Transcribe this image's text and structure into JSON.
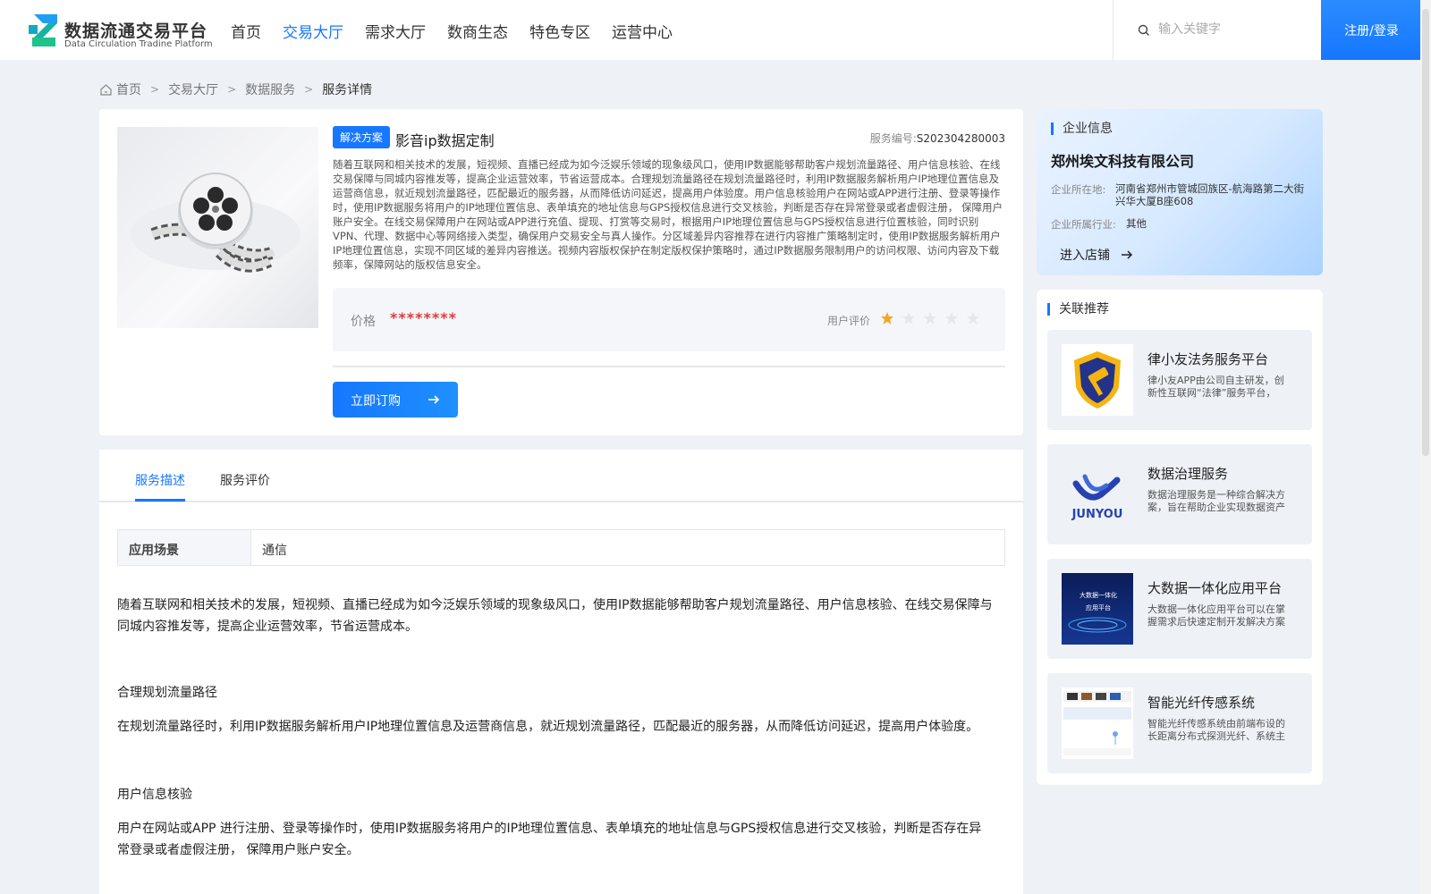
{
  "header": {
    "logo_title": "数据流通交易平台",
    "logo_subtitle": "Data Circulation Tradine Platform",
    "nav": [
      "首页",
      "交易大厅",
      "需求大厅",
      "数商生态",
      "特色专区",
      "运营中心"
    ],
    "active_nav_index": 1,
    "search_placeholder": "输入关键字",
    "login_label": "注册/登录"
  },
  "breadcrumb": [
    "首页",
    "交易大厅",
    "数据服务",
    "服务详情"
  ],
  "product": {
    "tag": "解决方案",
    "title": "影音ip数据定制",
    "service_no_label": "服务编号:",
    "service_no": "S202304280003",
    "description": "随着互联网和相关技术的发展，短视频、直播已经成为如今泛娱乐领域的现象级风口，使用IP数据能够帮助客户规划流量路径、用户信息核验、在线交易保障与同城内容推发等，提高企业运营效率，节省运营成本。合理规划流量路径在规划流量路径时，利用IP数据服务解析用户IP地理位置信息及运营商信息，就近规划流量路径，匹配最近的服务器，从而降低访问延迟，提高用户体验度。用户信息核验用户在网站或APP进行注册、登录等操作时，使用IP数据服务将用户的IP地理位置信息、表单填充的地址信息与GPS授权信息进行交叉核验，判断是否存在异常登录或者虚假注册， 保障用户账户安全。在线交易保障用户在网站或APP进行充值、提现、打赏等交易时，根据用户IP地理位置信息与GPS授权信息进行位置核验，同时识别VPN、代理、数据中心等网络接入类型，确保用户交易安全与真人操作。分区域差异内容推荐在进行内容推广策略制定时，使用IP数据服务解析用户IP地理位置信息，实现不同区域的差异内容推送。视频内容版权保护在制定版权保护策略时，通过IP数据服务限制用户的访问权限、访问内容及下载频率，保障网站的版权信息安全。",
    "price_label": "价格",
    "price": "********",
    "rating_label": "用户评价",
    "rating": 1,
    "rating_max": 5,
    "order_label": "立即订购"
  },
  "details": {
    "tabs": [
      "服务描述",
      "服务评价"
    ],
    "active_tab": 0,
    "scene_key": "应用场景",
    "scene_value": "通信",
    "paragraphs": [
      "随着互联网和相关技术的发展，短视频、直播已经成为如今泛娱乐领域的现象级风口，使用IP数据能够帮助客户规划流量路径、用户信息核验、在线交易保障与同城内容推发等，提高企业运营效率，节省运营成本。",
      "合理规划流量路径",
      "在规划流量路径时，利用IP数据服务解析用户IP地理位置信息及运营商信息，就近规划流量路径，匹配最近的服务器，从而降低访问延迟，提高用户体验度。",
      "用户信息核验",
      "用户在网站或APP 进行注册、登录等操作时，使用IP数据服务将用户的IP地理位置信息、表单填充的地址信息与GPS授权信息进行交叉核验，判断是否存在异常登录或者虚假注册， 保障用户账户安全。"
    ]
  },
  "company": {
    "section_title": "企业信息",
    "name": "郑州埃文科技有限公司",
    "location_label": "企业所在地:",
    "location": "河南省郑州市管城回族区-航海路第二大街兴华大厦B座608",
    "industry_label": "企业所属行业:",
    "industry": "其他",
    "enter_label": "进入店铺"
  },
  "recommend": {
    "section_title": "关联推荐",
    "items": [
      {
        "title": "律小友法务服务平台",
        "desc": "律小友APP由公司自主研发，创新性互联网“法律”服务平台，",
        "thumb": "gavel-shield-icon"
      },
      {
        "title": "数据治理服务",
        "desc": "数据治理服务是一种综合解决方案，旨在帮助企业实现数据资产价值",
        "thumb": "junyou-logo",
        "thumb_text": "JUNYOU"
      },
      {
        "title": "大数据一体化应用平台",
        "desc": "大数据一体化应用平台可以在掌握需求后快速定制开发解决方案",
        "thumb": "bigdata-banner",
        "thumb_text": "大数据一体化\n应用平台"
      },
      {
        "title": "智能光纤传感系统",
        "desc": "智能光纤传感系统由前端布设的长距离分布式探测光纤、系统主机",
        "thumb": "fiber-dashboard"
      }
    ]
  },
  "colors": {
    "accent": "#1677ff",
    "price": "#e03a3a",
    "star": "#f5a623"
  }
}
